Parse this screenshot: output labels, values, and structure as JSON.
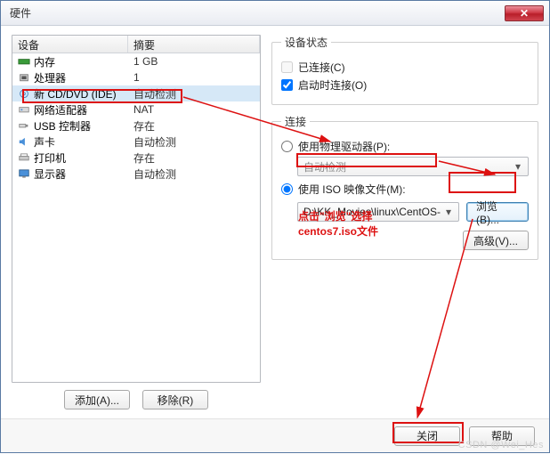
{
  "title": "硬件",
  "table": {
    "head_device": "设备",
    "head_summary": "摘要",
    "rows": [
      {
        "icon": "mem",
        "name": "内存",
        "summary": "1 GB"
      },
      {
        "icon": "cpu",
        "name": "处理器",
        "summary": "1"
      },
      {
        "icon": "cd",
        "name": "新 CD/DVD (IDE)",
        "summary": "自动检测",
        "selected": true
      },
      {
        "icon": "net",
        "name": "网络适配器",
        "summary": "NAT"
      },
      {
        "icon": "usb",
        "name": "USB 控制器",
        "summary": "存在"
      },
      {
        "icon": "snd",
        "name": "声卡",
        "summary": "自动检测"
      },
      {
        "icon": "prn",
        "name": "打印机",
        "summary": "存在"
      },
      {
        "icon": "disp",
        "name": "显示器",
        "summary": "自动检测"
      }
    ]
  },
  "left_buttons": {
    "add": "添加(A)...",
    "remove": "移除(R)"
  },
  "status": {
    "legend": "设备状态",
    "connected": "已连接(C)",
    "connect_on_power": "启动时连接(O)"
  },
  "connection": {
    "legend": "连接",
    "use_physical": "使用物理驱动器(P):",
    "auto_detect": "自动检测",
    "use_iso": "使用 ISO 映像文件(M):",
    "iso_path": "D:\\KK_Movies\\linux\\CentOS-",
    "browse": "浏览(B)...",
    "advanced": "高级(V)..."
  },
  "footer": {
    "close": "关闭",
    "help": "帮助"
  },
  "annotation": {
    "line1": "点击\"浏览\"选择",
    "line2": "centos7.iso文件"
  },
  "watermark": "CSDN @Wei_Hes"
}
